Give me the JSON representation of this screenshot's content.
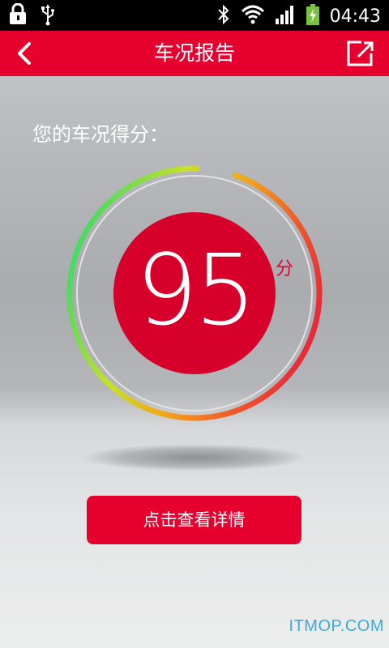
{
  "status_bar": {
    "time": "04:43",
    "icons": [
      "lock-icon",
      "usb-icon",
      "bluetooth-icon",
      "wifi-icon",
      "signal-icon",
      "battery-charging-icon"
    ]
  },
  "header": {
    "title": "车况报告",
    "back_icon": "chevron-left-icon",
    "share_icon": "share-icon",
    "background_color": "#e6002d"
  },
  "score": {
    "label": "您的车况得分：",
    "value": "95",
    "unit": "分",
    "max": 100,
    "fraction": 0.95
  },
  "actions": {
    "detail_button": "点击查看详情"
  },
  "watermark": "ITMOP.COM",
  "colors": {
    "accent_red": "#e6002d",
    "gauge_green": "#4cd964",
    "gauge_yellow": "#e8e22a",
    "gauge_orange": "#f39a1e",
    "gauge_red": "#e62a3a"
  }
}
